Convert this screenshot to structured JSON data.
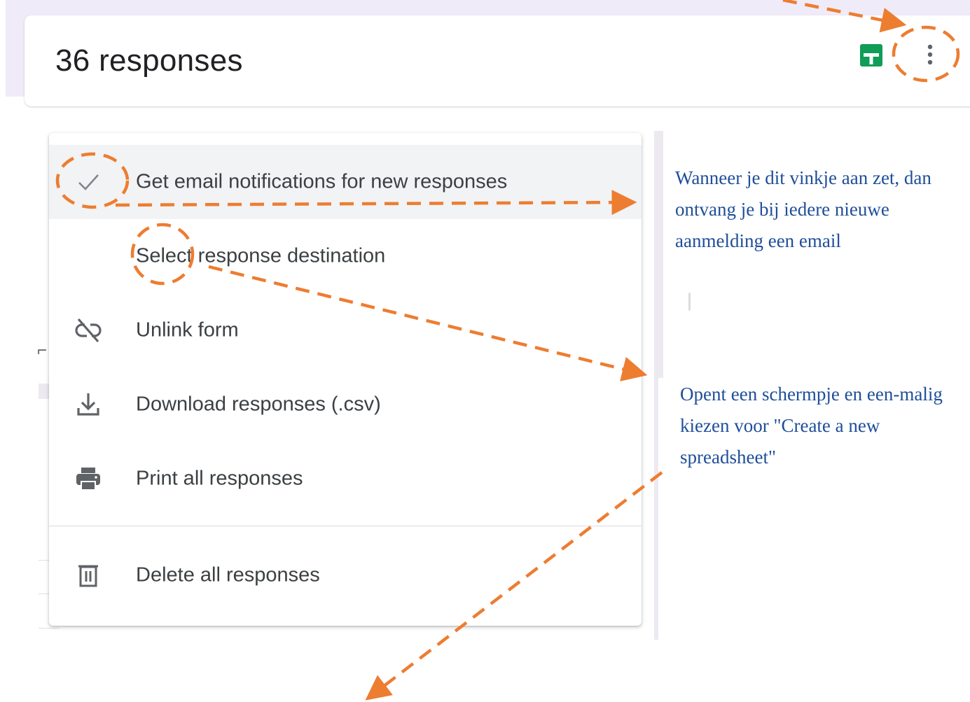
{
  "header": {
    "title": "36 responses",
    "sheets_icon": "google-sheets-icon",
    "more_icon": "more-vert-icon"
  },
  "menu": {
    "items": [
      {
        "label": "Get email notifications for new responses",
        "icon": "check-icon",
        "checked": true
      },
      {
        "label": "Select response destination",
        "icon": ""
      },
      {
        "label": "Unlink form",
        "icon": "link-off-icon"
      },
      {
        "label": "Download responses (.csv)",
        "icon": "download-icon"
      },
      {
        "label": "Print all responses",
        "icon": "print-icon"
      },
      {
        "label": "Delete all responses",
        "icon": "trash-icon"
      }
    ]
  },
  "annotations": {
    "notifications_note": "Wanneer je dit vinkje aan zet, dan ontvang je bij iedere nieuwe aanmelding een email",
    "destination_note": "Opent een schermpje en een-malig kiezen voor  \"Create a new spreadsheet\""
  },
  "colors": {
    "annotation_orange": "#ed7d31",
    "annotation_text": "#1f4e99",
    "sheets_green": "#0f9d58",
    "page_background": "#f0ebf8"
  }
}
